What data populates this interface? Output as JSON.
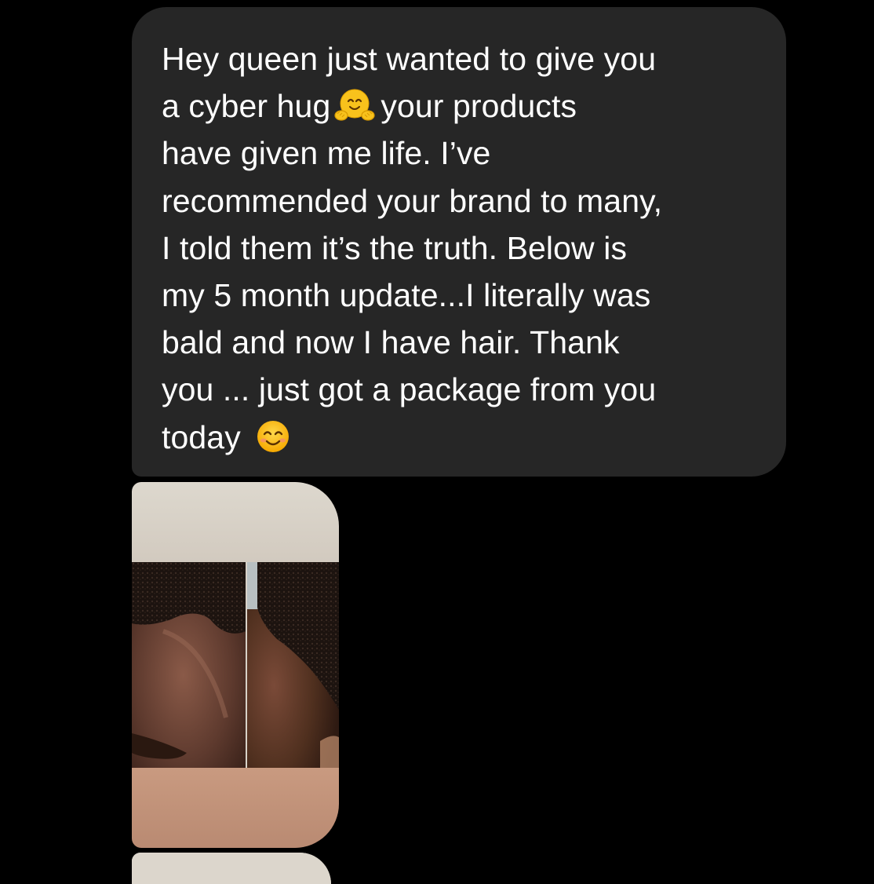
{
  "message": {
    "lines": [
      "Hey queen just wanted to give you",
      "a cyber hug",
      "your products",
      "have given me life. I’ve",
      "recommended your brand to many,",
      "I told them it’s the truth. Below is",
      "my 5 month update...I literally was",
      "bald and now I have hair. Thank",
      "you ... just got a package from you",
      "today"
    ],
    "emojis": [
      "hugging-face-emoji",
      "smiling-face-with-smiling-eyes-emoji"
    ]
  },
  "attachments": [
    {
      "type": "photo",
      "description_icon": "hair-growth-before-after-photo"
    },
    {
      "type": "photo",
      "description_icon": "second-photo-partial"
    }
  ],
  "colors": {
    "background": "#000000",
    "bubble": "#262626",
    "text": "#ffffff",
    "emoji": "#f5b400"
  }
}
